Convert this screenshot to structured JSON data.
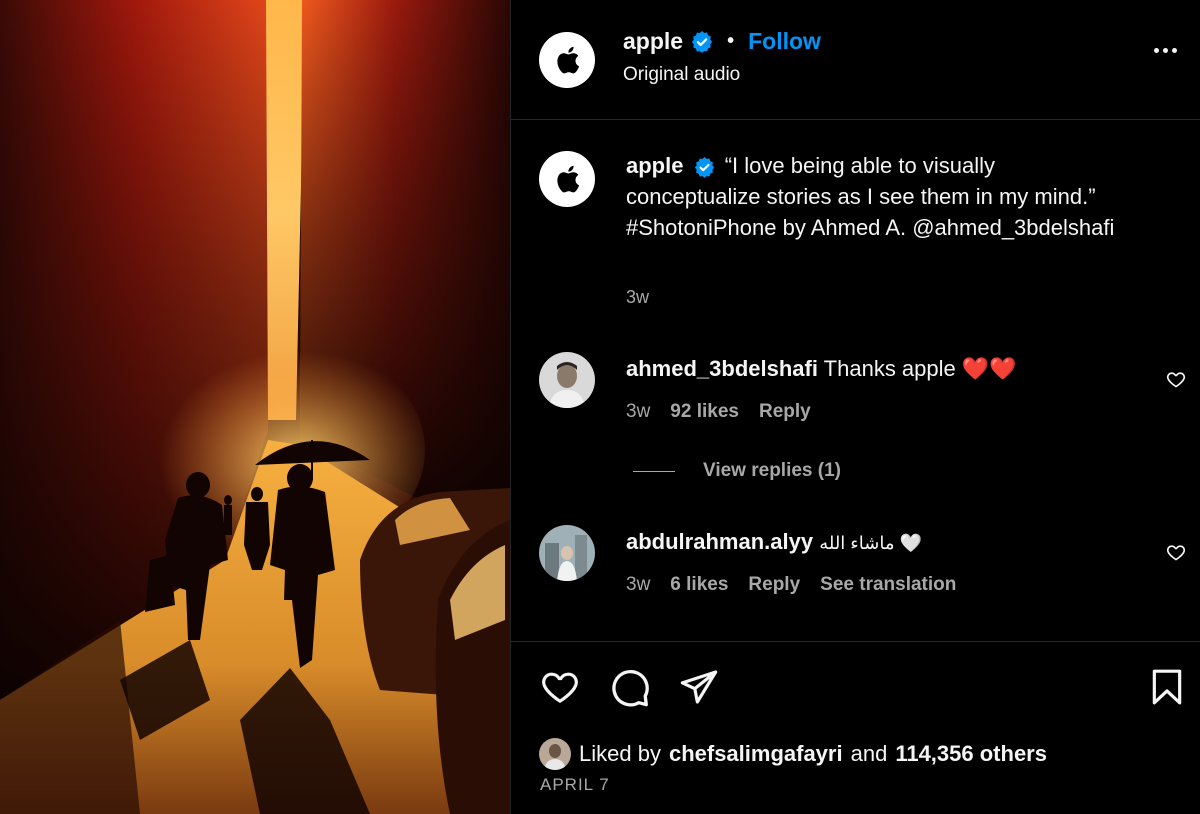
{
  "header": {
    "username": "apple",
    "separator": "•",
    "follow_label": "Follow",
    "audio": "Original audio"
  },
  "caption": {
    "username": "apple",
    "text": "“I love being able to visually conceptualize stories as I see them in my mind.” #ShotoniPhone by Ahmed A. @ahmed_3bdelshafi",
    "time": "3w"
  },
  "comments": [
    {
      "username": "ahmed_3bdelshafi",
      "text": "Thanks apple ❤️❤️",
      "time": "3w",
      "likes": "92 likes",
      "reply_label": "Reply"
    },
    {
      "username": "abdulrahman.alyy",
      "text": "ماشاء الله 🤍",
      "time": "3w",
      "likes": "6 likes",
      "reply_label": "Reply",
      "translate_label": "See translation"
    }
  ],
  "view_replies": "View replies (1)",
  "likes": {
    "prefix": "Liked by",
    "user": "chefsalimgafayri",
    "joiner": "and",
    "others": "114,356 others"
  },
  "date": "APRIL 7",
  "colors": {
    "accent": "#0095f6",
    "verified": "#0095f6",
    "secondary_text": "#a8a8a8",
    "heart": "#ff3040"
  },
  "icons": [
    "apple-logo-icon",
    "verified-badge-icon",
    "more-options-icon",
    "heart-icon",
    "comment-icon",
    "share-icon",
    "bookmark-icon"
  ]
}
